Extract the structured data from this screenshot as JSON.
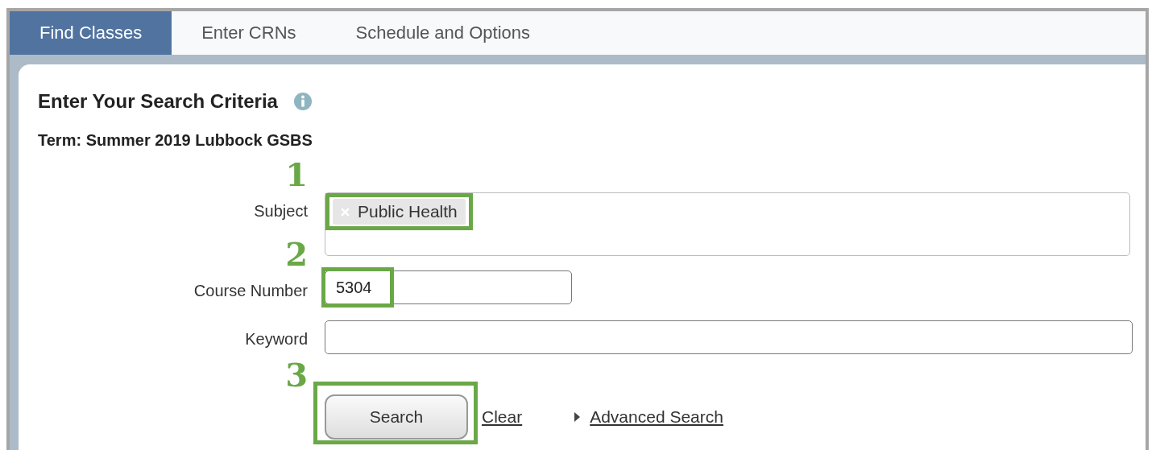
{
  "tabs": [
    {
      "label": "Find Classes",
      "selected": true
    },
    {
      "label": "Enter CRNs",
      "selected": false
    },
    {
      "label": "Schedule and Options",
      "selected": false
    }
  ],
  "panel": {
    "title": "Enter Your Search Criteria",
    "term": "Term: Summer 2019 Lubbock GSBS"
  },
  "fields": [
    {
      "kind": "chips",
      "label": "Subject",
      "chips": [
        "Public Health"
      ],
      "step": "1"
    },
    {
      "kind": "text",
      "label": "Course Number",
      "value": "5304",
      "step": "2"
    },
    {
      "kind": "wide",
      "label": "Keyword"
    }
  ],
  "actions": {
    "search_button": "Search",
    "search_step": "3",
    "clear_link": "Clear",
    "advanced_link": "Advanced Search"
  }
}
